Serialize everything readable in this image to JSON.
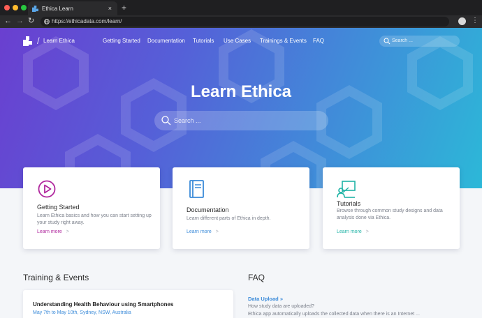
{
  "browser": {
    "tab_title": "Ethica Learn",
    "tab_close": "×",
    "new_tab": "+",
    "back": "←",
    "forward": "→",
    "reload": "↻",
    "url": "https://ethicadata.com/learn/",
    "menu": "⋮"
  },
  "site_nav": {
    "logo_text": "Learn Ethica",
    "separator": "/",
    "links": [
      "Getting Started",
      "Documentation",
      "Tutorials",
      "Use Cases",
      "Trainings & Events",
      "FAQ"
    ],
    "search_placeholder": "Search ..."
  },
  "hero": {
    "title": "Learn Ethica",
    "search_placeholder": "Search ..."
  },
  "cards": [
    {
      "title": "Getting Started",
      "description": "Learn Ethica basics and how you can start setting up your study right away.",
      "link": "Learn more",
      "icon": "play-circle-icon",
      "accent": "#b0289e"
    },
    {
      "title": "Documentation",
      "description": "Learn different parts of Ethica in depth.",
      "link": "Learn more",
      "icon": "book-icon",
      "accent": "#3b8bd9"
    },
    {
      "title": "Tutorials",
      "description": "Browse through common study designs and data analysis done via Ethica.",
      "link": "Learn more",
      "icon": "presentation-icon",
      "accent": "#20b3a6"
    }
  ],
  "training": {
    "heading": "Training & Events",
    "event_title": "Understanding Health Behaviour using Smartphones",
    "event_meta": "May 7th to May 10th, Sydney, NSW, Australia"
  },
  "faq": {
    "heading": "FAQ",
    "item_title": "Data Upload »",
    "item_question": "How study data are uploaded?",
    "item_answer": "Ethica app automatically uploads the collected data when there is an Internet ..."
  },
  "colors": {
    "hero_gradient_start": "#6a3fd0",
    "hero_gradient_end": "#2cb8d8",
    "link_blue": "#3b8bd9"
  }
}
